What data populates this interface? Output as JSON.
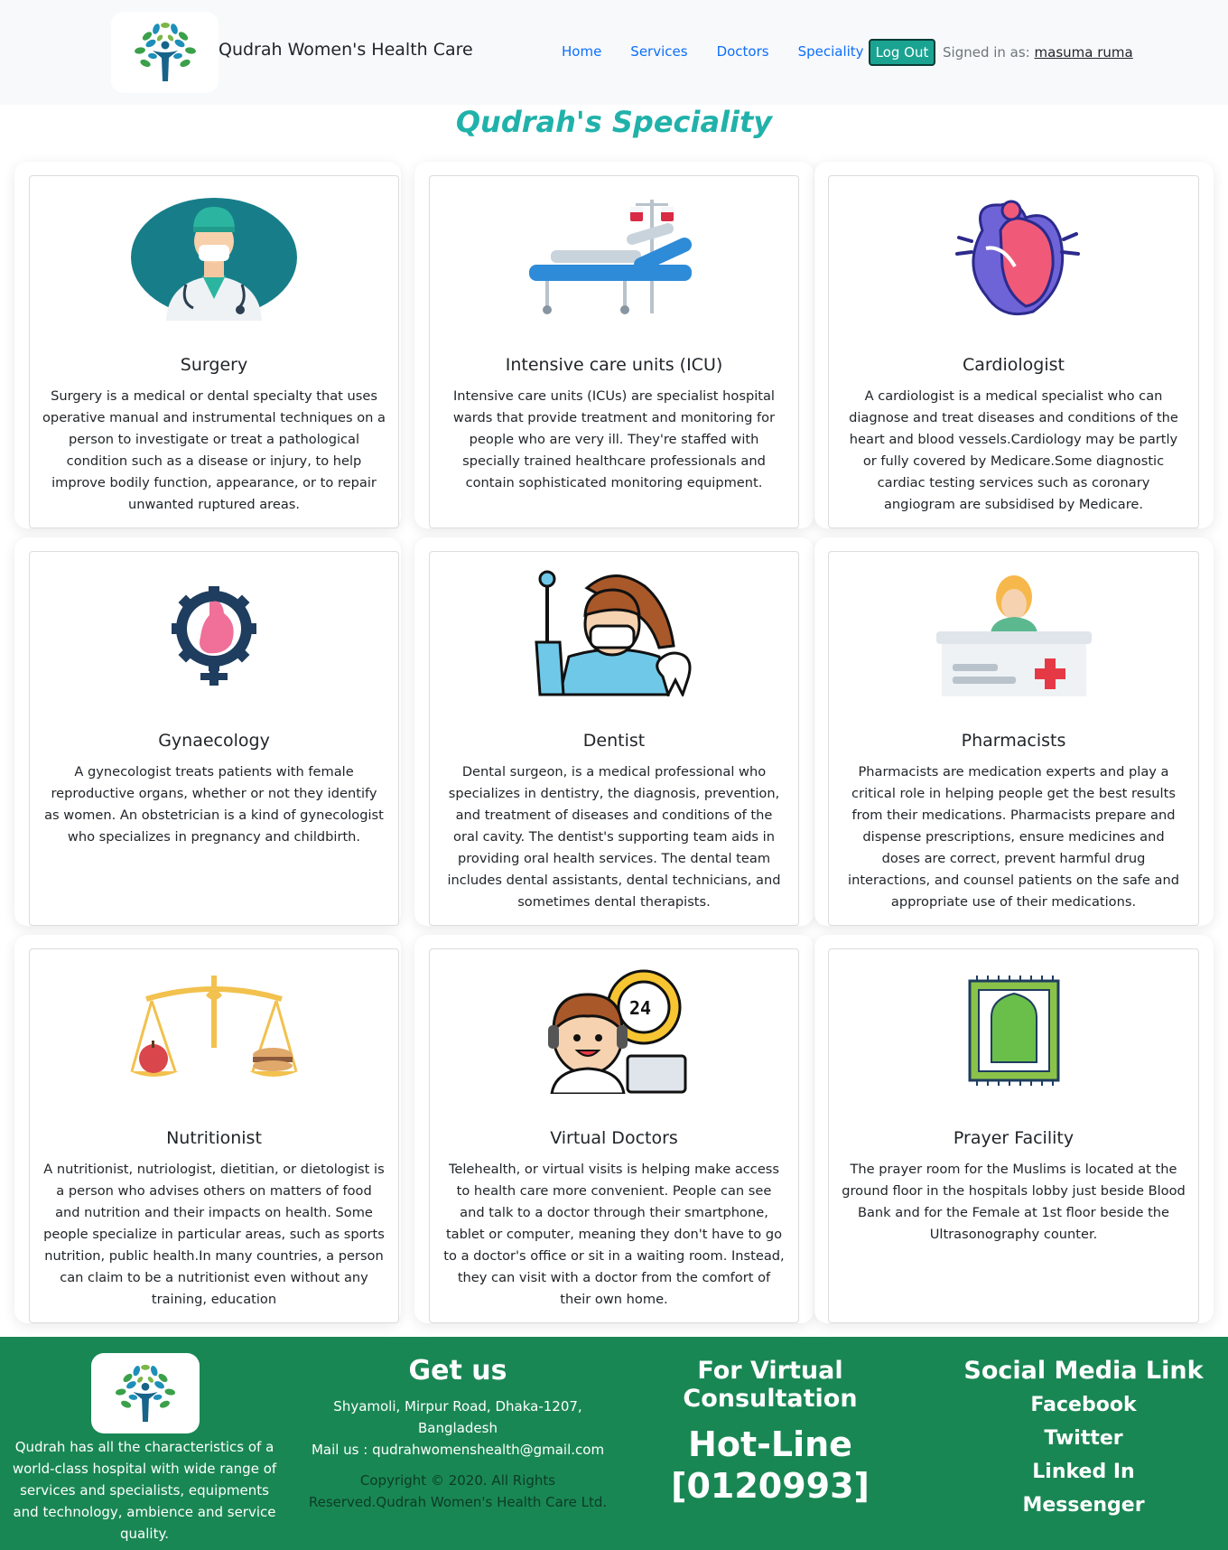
{
  "navbar": {
    "brand": "Qudrah Women's Health Care",
    "links": [
      "Home",
      "Services",
      "Doctors",
      "Speciality"
    ],
    "logout_label": "Log Out",
    "signed_in_prefix": "Signed in as: ",
    "user_name": "masuma ruma"
  },
  "page_title": "Qudrah's Speciality",
  "cards": [
    {
      "title": "Surgery",
      "icon": "surgeon-icon",
      "text": "Surgery is a medical or dental specialty that uses operative manual and instrumental techniques on a person to investigate or treat a pathological condition such as a disease or injury, to help improve bodily function, appearance, or to repair unwanted ruptured areas."
    },
    {
      "title": "Intensive care units (ICU)",
      "icon": "hospital-bed-icon",
      "text": "Intensive care units (ICUs) are specialist hospital wards that provide treatment and monitoring for people who are very ill. They're staffed with specially trained healthcare professionals and contain sophisticated monitoring equipment."
    },
    {
      "title": "Cardiologist",
      "icon": "heart-icon",
      "text": "A cardiologist is a medical specialist who can diagnose and treat diseases and conditions of the heart and blood vessels.Cardiology may be partly or fully covered by Medicare.Some diagnostic cardiac testing services such as coronary angiogram are subsidised by Medicare."
    },
    {
      "title": "Gynaecology",
      "icon": "gynaecology-icon",
      "text": "A gynecologist treats patients with female reproductive organs, whether or not they identify as women. An obstetrician is a kind of gynecologist who specializes in pregnancy and childbirth."
    },
    {
      "title": "Dentist",
      "icon": "dentist-icon",
      "text": "Dental surgeon, is a medical professional who specializes in dentistry, the diagnosis, prevention, and treatment of diseases and conditions of the oral cavity. The dentist's supporting team aids in providing oral health services. The dental team includes dental assistants, dental technicians, and sometimes dental therapists."
    },
    {
      "title": "Pharmacists",
      "icon": "pharmacy-counter-icon",
      "text": "Pharmacists are medication experts and play a critical role in helping people get the best results from their medications. Pharmacists prepare and dispense prescriptions, ensure medicines and doses are correct, prevent harmful drug interactions, and counsel patients on the safe and appropriate use of their medications."
    },
    {
      "title": "Nutritionist",
      "icon": "balance-scale-icon",
      "text": "A nutritionist, nutriologist, dietitian, or dietologist is a person who advises others on matters of food and nutrition and their impacts on health. Some people specialize in particular areas, such as sports nutrition, public health.In many countries, a person can claim to be a nutritionist even without any training, education"
    },
    {
      "title": "Virtual Doctors",
      "icon": "virtual-doctor-icon",
      "text": "Telehealth, or virtual visits is helping make access to health care more convenient. People can see and talk to a doctor through their smartphone, tablet or computer, meaning they don't have to go to a doctor's office or sit in a waiting room. Instead, they can visit with a doctor from the comfort of their own home."
    },
    {
      "title": "Prayer Facility",
      "icon": "prayer-mat-icon",
      "text": "The prayer room for the Muslims is located at the ground floor in the hospitals lobby just beside Blood Bank and for the Female at 1st floor beside the Ultrasonography counter."
    }
  ],
  "footer": {
    "about": "Qudrah has all the characteristics of a world-class hospital with wide range of services and specialists, equipments and technology, ambience and service quality.",
    "get_us_title": "Get us",
    "address": "Shyamoli, Mirpur Road, Dhaka-1207, Bangladesh",
    "mail": "Mail us : qudrahwomenshealth@gmail.com",
    "copyright": "Copyright © 2020. All Rights Reserved.Qudrah Women's Health Care Ltd.",
    "virtual_title": "For Virtual Consultation",
    "hotline_label": "Hot-Line",
    "hotline_number": "[0120993]",
    "social_title": "Social Media Link",
    "social_links": [
      "Facebook",
      "Twitter",
      "Linked In",
      "Messenger"
    ]
  },
  "colors": {
    "accent": "#20b2aa",
    "logout": "#1aa391",
    "footer": "#198754",
    "link": "#0d6efd"
  }
}
